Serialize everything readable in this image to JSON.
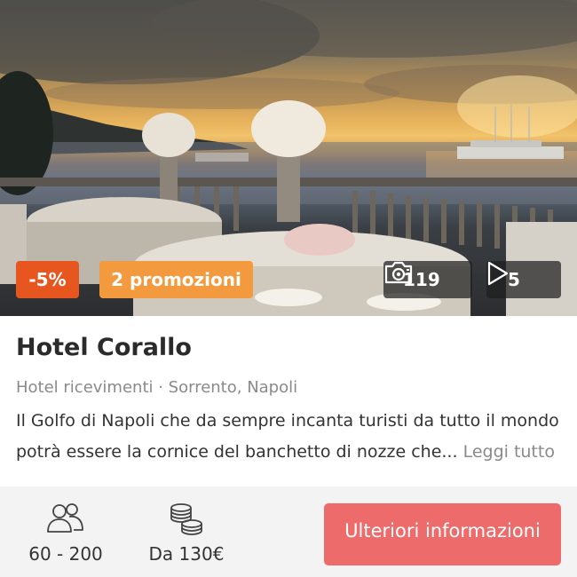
{
  "hero": {
    "discount_badge": "-5%",
    "promotions_badge": "2 promozioni",
    "photos_count": "119",
    "videos_count": "5"
  },
  "venue": {
    "name": "Hotel Corallo",
    "meta": "Hotel ricevimenti · Sorrento, Napoli",
    "description": "Il Golfo di Napoli che da sempre incanta turisti da tutto il mondo potrà essere la cornice del banchetto di nozze che...",
    "read_more": "Leggi tutto"
  },
  "footer": {
    "capacity": "60 - 200",
    "price": "Da 130€",
    "cta_label": "Ulteriori informazioni"
  },
  "colors": {
    "discount": "#e8561f",
    "promo": "#f39a3f",
    "cta": "#ee6b6b"
  },
  "icons": {
    "photos": "camera-icon",
    "videos": "play-icon",
    "capacity": "guests-icon",
    "price": "coins-icon"
  }
}
